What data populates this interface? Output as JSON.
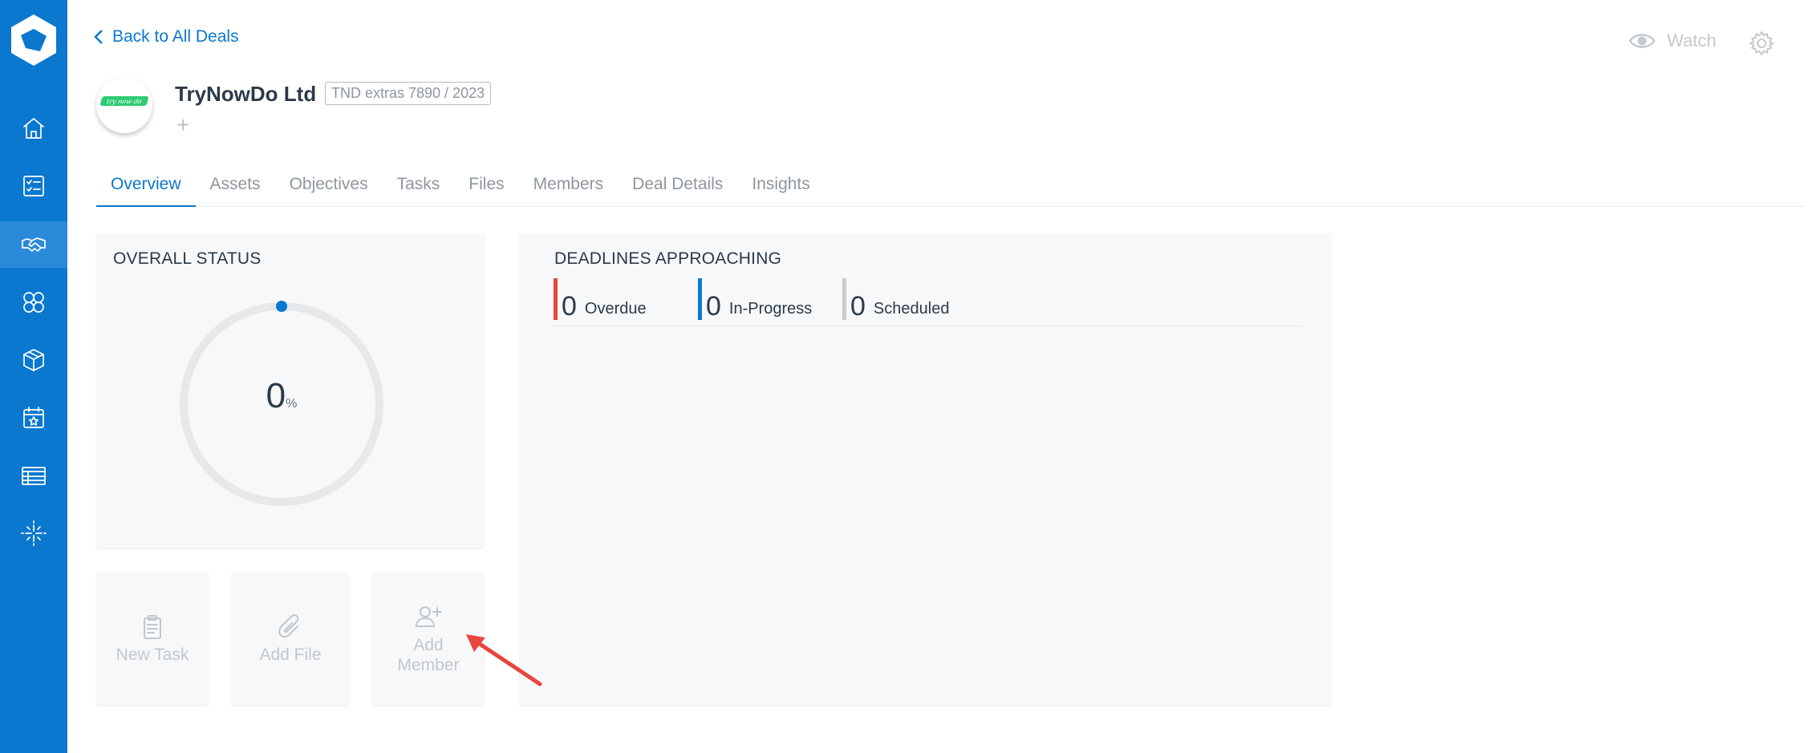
{
  "sidebar": {
    "items": [
      {
        "icon": "home-icon"
      },
      {
        "icon": "checklist-icon"
      },
      {
        "icon": "handshake-icon",
        "active": true
      },
      {
        "icon": "group-icon"
      },
      {
        "icon": "box-icon"
      },
      {
        "icon": "calendar-star-icon"
      },
      {
        "icon": "table-icon"
      },
      {
        "icon": "sparkle-icon"
      }
    ]
  },
  "header": {
    "back_label": "Back to All Deals",
    "watch_label": "Watch",
    "company_name": "TryNowDo Ltd",
    "deal_tag": "TND extras 7890 / 2023",
    "add_label": "+",
    "logo_text": "try now do"
  },
  "tabs": [
    {
      "label": "Overview",
      "active": true
    },
    {
      "label": "Assets"
    },
    {
      "label": "Objectives"
    },
    {
      "label": "Tasks"
    },
    {
      "label": "Files"
    },
    {
      "label": "Members"
    },
    {
      "label": "Deal Details"
    },
    {
      "label": "Insights"
    }
  ],
  "status": {
    "title": "OVERALL STATUS",
    "value": "0",
    "unit": "%",
    "percent": 0
  },
  "actions": {
    "new_task": "New Task",
    "add_file": "Add File",
    "add_member_line1": "Add",
    "add_member_line2": "Member"
  },
  "deadlines": {
    "title": "DEADLINES APPROACHING",
    "stats": [
      {
        "count": "0",
        "label": "Overdue",
        "color": "#e8473e"
      },
      {
        "count": "0",
        "label": "In-Progress",
        "color": "#0a78cf"
      },
      {
        "count": "0",
        "label": "Scheduled",
        "color": "#c9cdd1"
      }
    ]
  },
  "colors": {
    "accent": "#0a78cf",
    "sidebar": "#0a78cf",
    "annotation_arrow": "#e8473e"
  }
}
